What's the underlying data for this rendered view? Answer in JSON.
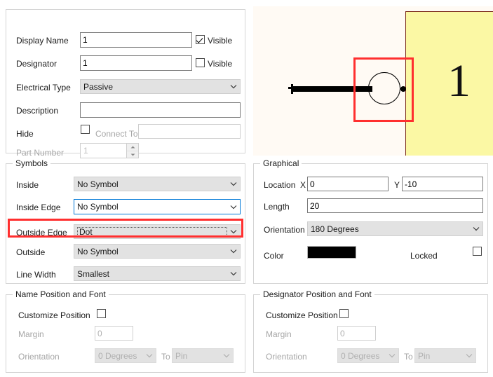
{
  "pin_properties": {
    "fields": {
      "display_name": {
        "label": "Display Name",
        "value": "1",
        "visible_label": "Visible",
        "visible_checked": true
      },
      "designator": {
        "label": "Designator",
        "value": "1",
        "visible_label": "Visible",
        "visible_checked": false
      },
      "electrical_type": {
        "label": "Electrical Type",
        "value": "Passive"
      },
      "description": {
        "label": "Description",
        "value": ""
      },
      "hide": {
        "label": "Hide",
        "checked": false,
        "connect_to_label": "Connect To",
        "connect_to_value": ""
      },
      "part_number": {
        "label": "Part Number",
        "value": "1"
      }
    }
  },
  "symbols": {
    "title": "Symbols",
    "rows": [
      {
        "label": "Inside",
        "value": "No Symbol",
        "state": "normal"
      },
      {
        "label": "Inside Edge",
        "value": "No Symbol",
        "state": "focus-blue"
      },
      {
        "label": "Outside Edge",
        "value": "Dot",
        "state": "selected-dotted"
      },
      {
        "label": "Outside",
        "value": "No Symbol",
        "state": "normal"
      },
      {
        "label": "Line Width",
        "value": "Smallest",
        "state": "normal"
      }
    ],
    "highlight_color": "#ff2f2f"
  },
  "graphical": {
    "title": "Graphical",
    "location_label": "Location",
    "x_label": "X",
    "x_value": "0",
    "y_label": "Y",
    "y_value": "-10",
    "length_label": "Length",
    "length_value": "20",
    "orientation_label": "Orientation",
    "orientation_value": "180 Degrees",
    "color_label": "Color",
    "color_value": "#000000",
    "locked_label": "Locked",
    "locked_checked": false
  },
  "name_position": {
    "title": "Name Position and Font",
    "customize_label": "Customize Position",
    "customize_checked": false,
    "margin_label": "Margin",
    "margin_value": "0",
    "orientation_label": "Orientation",
    "orientation_value": "0 Degrees",
    "to_label": "To",
    "to_value": "Pin"
  },
  "designator_position": {
    "title": "Designator Position and Font",
    "customize_label": "Customize Position",
    "customize_checked": false,
    "margin_label": "Margin",
    "margin_value": "0",
    "orientation_label": "Orientation",
    "orientation_value": "0 Degrees",
    "to_label": "To",
    "to_value": "Pin"
  },
  "preview": {
    "background_color": "#fffaf4",
    "body_fill_color": "#fbf8a4",
    "body_border_color": "#7a2a18",
    "pin_color": "#000000",
    "pin_number_text": "1",
    "selection_color": "#ff2f2f"
  }
}
